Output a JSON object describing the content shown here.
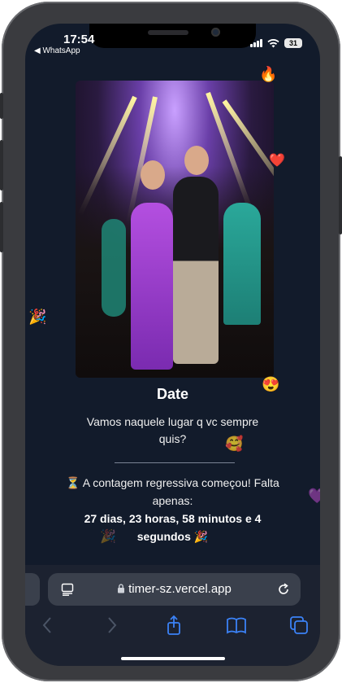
{
  "status": {
    "time": "17:54",
    "back_app": "◀ WhatsApp",
    "battery": "31"
  },
  "card": {
    "title": "Date",
    "subtitle": "Vamos naquele lugar q vc sempre quis?",
    "countdown_intro": "A contagem regressiva começou! Falta apenas:",
    "countdown_value": "27 dias, 23 horas, 58 minutos e 4 segundos",
    "hourglass_emoji": "⏳",
    "party_emoji": "🎉"
  },
  "floating_emojis": {
    "fire": "🔥",
    "heart": "❤️",
    "party_left": "🎉",
    "heart_eyes": "😍",
    "hearts_face": "🥰",
    "purple_heart": "💜",
    "party_faded": "🎉"
  },
  "browser": {
    "url": "timer-sz.vercel.app"
  },
  "colors": {
    "background": "#121b2b",
    "toolbar": "#1c2230",
    "accent": "#3b82f6"
  }
}
